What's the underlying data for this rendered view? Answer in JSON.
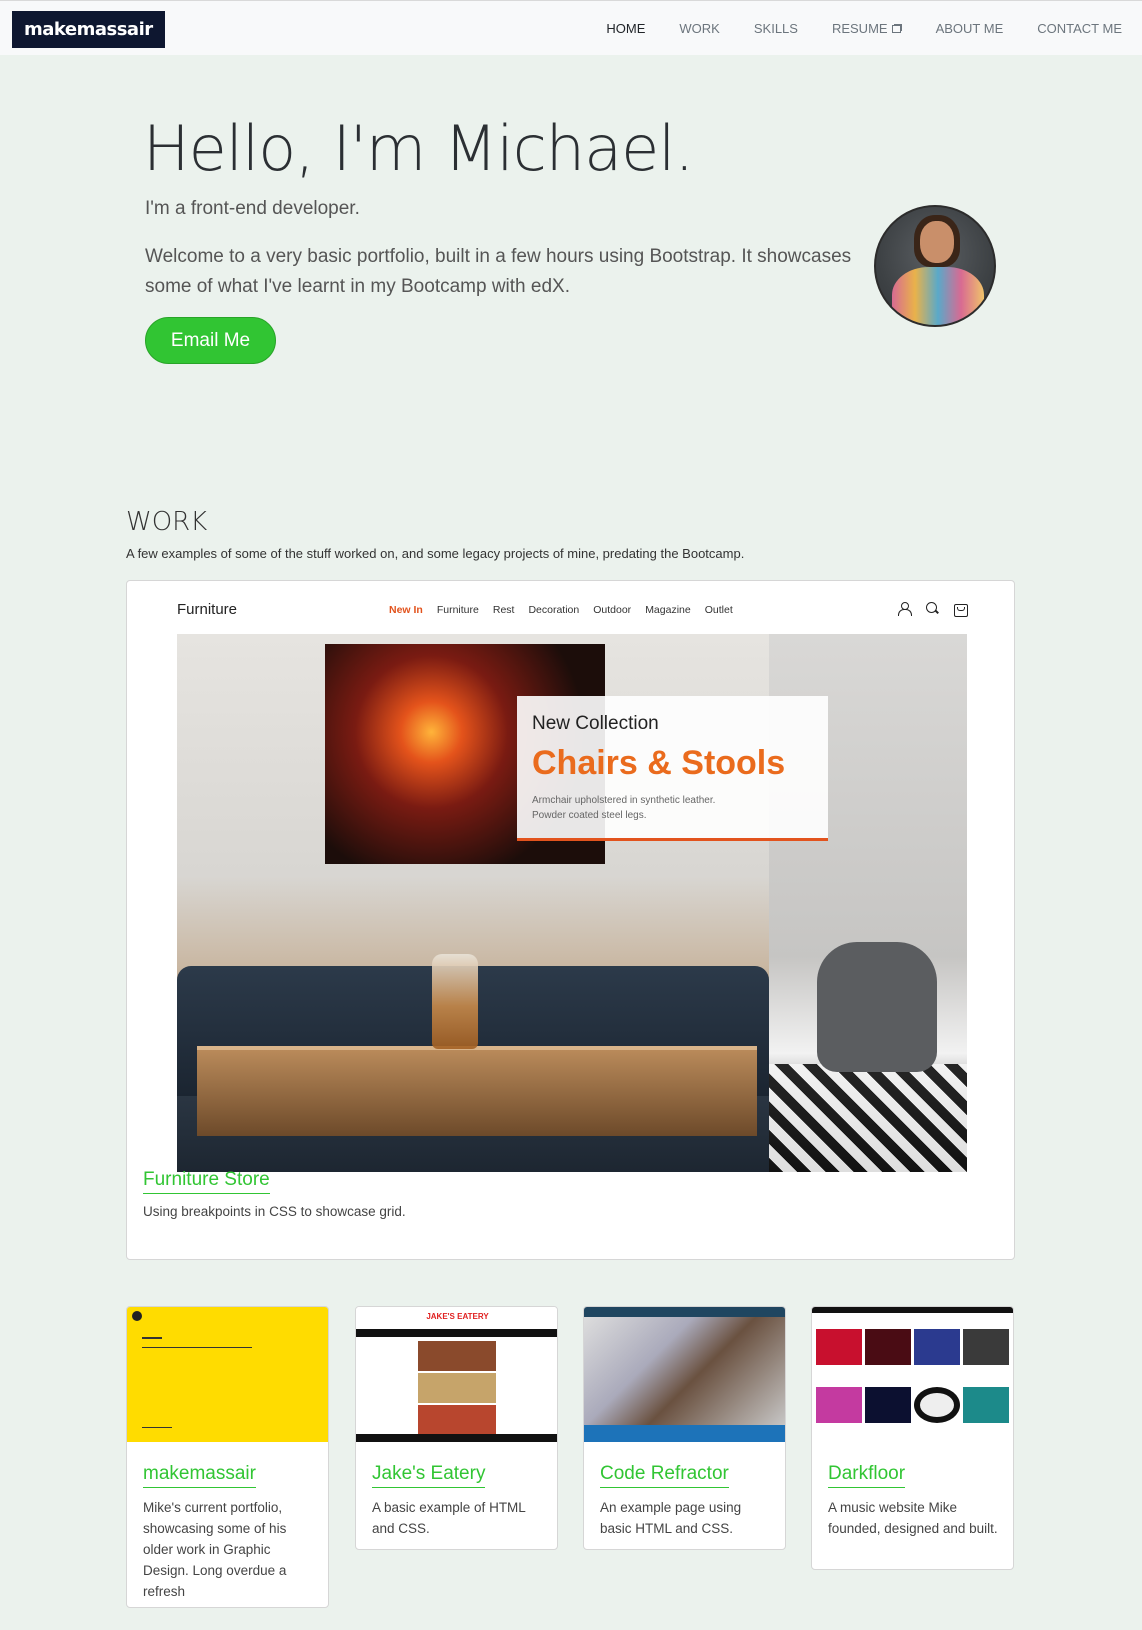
{
  "nav": {
    "brand": "makemassair",
    "links": [
      "HOME",
      "WORK",
      "SKILLS",
      "RESUME",
      "ABOUT ME",
      "CONTACT ME"
    ]
  },
  "hero": {
    "title": "Hello, I'm Michael.",
    "subtitle": "I'm a front-end developer.",
    "text": "Welcome to a very basic portfolio, built in a few hours using Bootstrap. It showcases some of what I've learnt in my Bootcamp with edX.",
    "button": "Email Me"
  },
  "work": {
    "title": "WORK",
    "description": "A few examples of some of the stuff worked on, and some legacy projects of mine, predating the Bootcamp.",
    "featured": {
      "shot": {
        "brand": "Furniture",
        "menu": [
          "New In",
          "Furniture",
          "Rest",
          "Decoration",
          "Outdoor",
          "Magazine",
          "Outlet"
        ],
        "overlay_small": "New Collection",
        "overlay_big": "Chairs & Stools",
        "overlay_line1": "Armchair upholstered in synthetic leather.",
        "overlay_line2": "Powder coated steel legs."
      },
      "title": "Furniture Store",
      "text": "Using breakpoints in CSS to showcase grid."
    },
    "projects": [
      {
        "title": "makemassair",
        "text": "Mike's current portfolio, showcasing some of his older work in Graphic Design. Long overdue a refresh"
      },
      {
        "title": "Jake's Eatery",
        "text": "A basic example of HTML and CSS.",
        "thumb_header": "JAKE'S EATERY"
      },
      {
        "title": "Code Refractor",
        "text": "An example page using basic HTML and CSS."
      },
      {
        "title": "Darkfloor",
        "text": "A music website Mike founded, designed and built."
      }
    ]
  },
  "colors": {
    "background": "#ebf2ed",
    "accent_green": "#31c533",
    "brand_navy": "#0e1730",
    "furniture_orange": "#ea6b1d"
  },
  "icons": [
    "external-window-icon",
    "user-icon",
    "search-icon",
    "shopping-bag-icon"
  ]
}
